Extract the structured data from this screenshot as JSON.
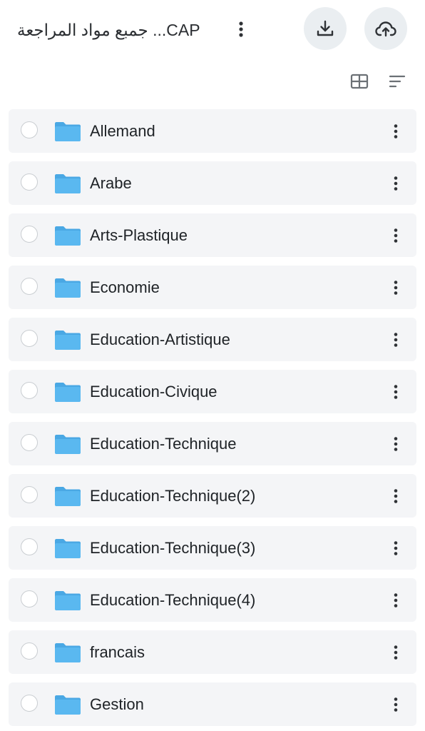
{
  "header": {
    "title": "جمبع مواد المراجعة ...CAP",
    "more_icon": "more-vert-icon",
    "download_icon": "download-icon",
    "upload_icon": "cloud-upload-icon"
  },
  "toolbar": {
    "grid_icon": "grid-view-icon",
    "sort_icon": "sort-icon"
  },
  "colors": {
    "folder": "#5ab8f0",
    "row_bg": "#f4f5f7",
    "circle_btn_bg": "#eaeef1",
    "icon": "#33363a"
  },
  "folders": [
    {
      "name": "Allemand"
    },
    {
      "name": "Arabe"
    },
    {
      "name": "Arts-Plastique"
    },
    {
      "name": "Economie"
    },
    {
      "name": "Education-Artistique"
    },
    {
      "name": "Education-Civique"
    },
    {
      "name": "Education-Technique"
    },
    {
      "name": "Education-Technique(2)"
    },
    {
      "name": "Education-Technique(3)"
    },
    {
      "name": "Education-Technique(4)"
    },
    {
      "name": "francais"
    },
    {
      "name": "Gestion"
    }
  ]
}
